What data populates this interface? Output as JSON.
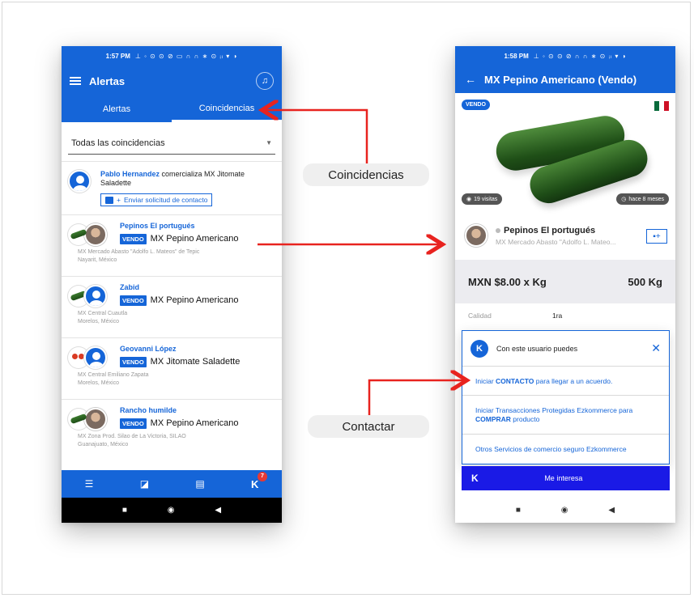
{
  "left_phone": {
    "status_time": "1:57 PM",
    "status_icons": "⊥ ◦ ⊙ ⊙ ⊘ ▭ ∩ ∩ ∗ ⊙ ᵢₗ ▾ ◑",
    "title": "Alertas",
    "tabs": [
      "Alertas",
      "Coincidencias"
    ],
    "filter_value": "Todas las coincidencias",
    "first_item": {
      "name": "Pablo Hernandez",
      "text": " comercializa MX Jitomate Saladette",
      "button": "Enviar solicitud de contacto"
    },
    "items": [
      {
        "seller": "Pepinos El portugués",
        "badge": "VENDO",
        "product": "MX Pepino Americano",
        "address": "MX Mercado Abasto \"Adolfo L. Mateos\" de Tepic\nNayarit, México"
      },
      {
        "seller": "Zabid",
        "badge": "VENDO",
        "product": "MX Pepino Americano",
        "address": "MX Central Cuautla\nMorelos, México"
      },
      {
        "seller": "Geovanni López",
        "badge": "VENDO",
        "product": "MX Jitomate Saladette",
        "address": "MX Central Emiliano Zapata\nMorelos, México"
      },
      {
        "seller": "Rancho humilde",
        "badge": "VENDO",
        "product": "MX Pepino Americano",
        "address": "MX Zona Prod. Silao de La Victoria, SILAO\nGuanajuato, México"
      }
    ],
    "nav_badge": "7"
  },
  "right_phone": {
    "status_time": "1:58 PM",
    "status_icons": "⊥ ◦ ⊙ ⊙ ⊘ ∩ ∩ ∗ ⊙ ᵢₗ ▾ ◑",
    "title": "MX Pepino Americano (Vendo)",
    "badge": "VENDO",
    "views": "19 visitas",
    "age": "hace 8 meses",
    "seller_name": "Pepinos El portugués",
    "seller_addr": "MX Mercado Abasto \"Adolfo L. Mateo...",
    "price": "MXN $8.00 x Kg",
    "quantity": "500 Kg",
    "quality_label": "Calidad",
    "quality_value": "1ra",
    "popup_title": "Con este usuario puedes",
    "option1_pre": "Iniciar ",
    "option1_bold": "CONTACTO",
    "option1_post": " para llegar a un acuerdo.",
    "option2_pre": "Iniciar Transacciones Protegidas Ezkommerce para ",
    "option2_bold": "COMPRAR",
    "option2_post": " producto",
    "option3": "Otros Servicios de comercio seguro Ezkommerce",
    "cta": "Me interesa"
  },
  "callouts": {
    "coincidencias": "Coincidencias",
    "contactar": "Contactar"
  },
  "colors": {
    "brand_blue": "#1565d8",
    "arrow_red": "#e8231f",
    "cta_blue": "#1a1ae6"
  }
}
